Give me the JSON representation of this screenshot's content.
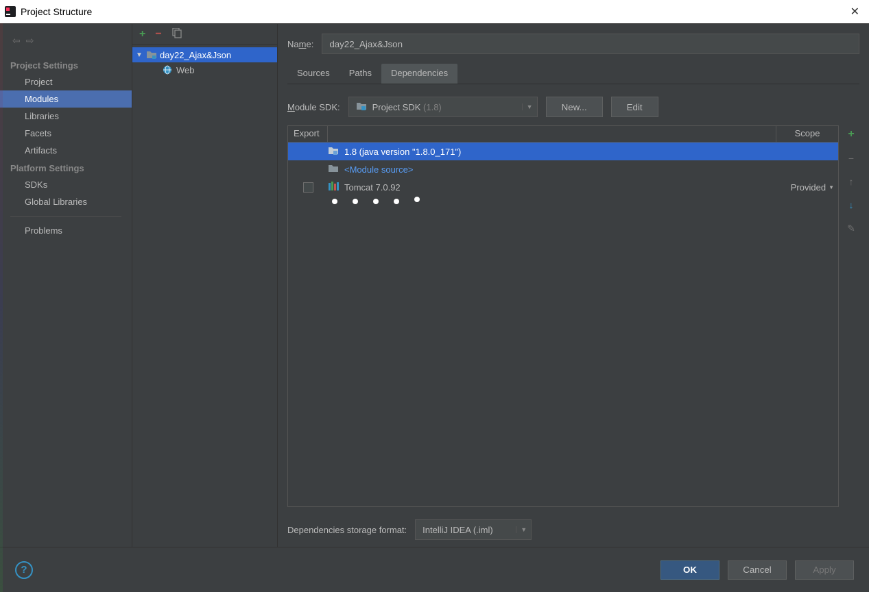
{
  "title": "Project Structure",
  "sidebar": {
    "project_settings_header": "Project Settings",
    "platform_settings_header": "Platform Settings",
    "items": {
      "project": "Project",
      "modules": "Modules",
      "libraries": "Libraries",
      "facets": "Facets",
      "artifacts": "Artifacts",
      "sdks": "SDKs",
      "global_libraries": "Global Libraries",
      "problems": "Problems"
    }
  },
  "tree": {
    "module_name": "day22_Ajax&Json",
    "child_label": "Web"
  },
  "form": {
    "name_label_prefix": "Na",
    "name_label_ul": "m",
    "name_label_suffix": "e:",
    "name_value": "day22_Ajax&Json",
    "tabs": {
      "sources": "Sources",
      "paths": "Paths",
      "dependencies": "Dependencies"
    },
    "sdk_label_ul": "M",
    "sdk_label_suffix": "odule SDK:",
    "sdk_value_main": "Project SDK",
    "sdk_value_dim": " (1.8)",
    "new_btn": "New...",
    "edit_btn": "Edit",
    "deps_header": {
      "export": "Export",
      "scope": "Scope"
    },
    "deps": {
      "jdk": "1.8 (java version \"1.8.0_171\")",
      "module_source": "<Module source>",
      "tomcat": "Tomcat 7.0.92",
      "tomcat_scope": "Provided"
    },
    "storage_label": "Dependencies storage format:",
    "storage_value": "IntelliJ IDEA (.iml)"
  },
  "footer": {
    "ok": "OK",
    "cancel": "Cancel",
    "apply": "Apply"
  }
}
